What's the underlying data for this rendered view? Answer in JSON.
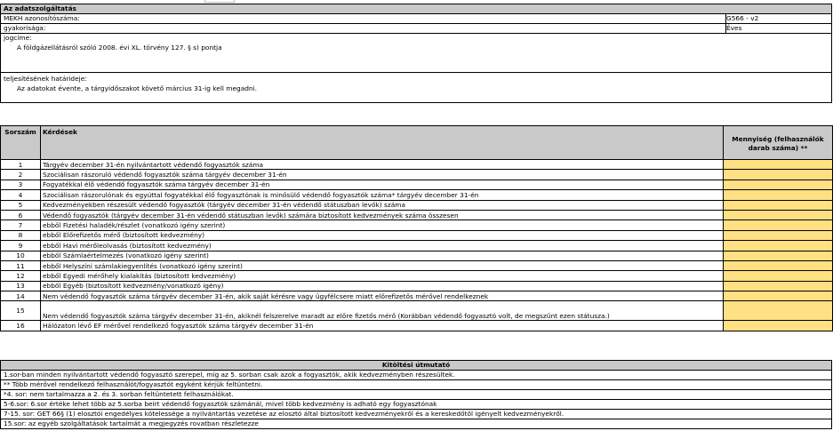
{
  "info": {
    "title": "Az adatszolgáltatás",
    "rows": [
      {
        "label": "MEKH azonosítószáma:",
        "value": "G566 - v2"
      },
      {
        "label": "gyakorisága:",
        "value": "Éves"
      }
    ],
    "legal_basis": {
      "label": "jogcíme:",
      "text": "A földgázellátásról szóló 2008. évi XL. törvény 127. § s) pontja"
    },
    "deadline": {
      "label": "teljesítésének határideje:",
      "text": "Az adatokat évente, a tárgyidőszakot követő március 31-ig kell megadni."
    }
  },
  "table": {
    "col_num": "Sorszám",
    "col_question": "Kérdések",
    "col_qty": "Mennyiség (felhasználók darab száma) **",
    "rows": [
      {
        "num": "1",
        "text": "Tárgyév december 31-én nyilvántartott védendő fogyasztók száma"
      },
      {
        "num": "2",
        "text": "Szociálisan rászoruló védendő fogyasztók száma tárgyév december 31-én"
      },
      {
        "num": "3",
        "text": "Fogyatékkal élő védendő fogyasztók száma tárgyév december 31-én"
      },
      {
        "num": "4",
        "text": "Szociálisan rászorulónak és egyúttal fogyatékkal élő fogyasztónak is minősülő védendő fogyasztók száma* tárgyév december 31-én"
      },
      {
        "num": "5",
        "text": "Kedvezményekben részesült védendő fogyasztók (tárgyév december 31-én védendő státuszban levők) száma"
      },
      {
        "num": "6",
        "text": "Védendő fogyasztók (tárgyév december 31-én védendő státuszban levők) számára biztosított kedvezmények száma összesen"
      },
      {
        "num": "7",
        "text": "ebből Fizetési haladék/részlet (vonatkozó igény szerint)"
      },
      {
        "num": "8",
        "text": "ebből Előrefizetős mérő (biztosított kedvezmény)"
      },
      {
        "num": "9",
        "text": "ebből Havi mérőleolvasás (biztosított kedvezmény)"
      },
      {
        "num": "10",
        "text": "ebből Számlaértelmezés (vonatkozó igény szerint)"
      },
      {
        "num": "11",
        "text": "ebből Helyszíni számlakiegyenlítés (vonatkozó igény szerint)"
      },
      {
        "num": "12",
        "text": "ebből Egyedi mérőhely kialakítás (biztosított kedvezmény)"
      },
      {
        "num": "13",
        "text": "ebből Egyéb (biztosított kedvezmény/vonatkozó igény)"
      },
      {
        "num": "14",
        "text": "Nem védendő fogyasztók száma tárgyév december 31-én, akik saját kérésre vagy ügyfélcsere miatt előrefizetős mérővel rendelkeznek"
      },
      {
        "num": "15",
        "text": "Nem védendő fogyasztók száma tárgyév december 31-én, akiknél felszerelve maradt az előre fizetős mérő (Korábban védendő fogyasztó volt, de megszűnt ezen státusza.)"
      },
      {
        "num": "16",
        "text": "Hálózaton lévő EF mérővel rendelkező fogyasztók száma tárgyév december 31-én"
      }
    ]
  },
  "instructions": {
    "title": "Kitöltési útmutató",
    "lines": [
      "1.sor-ban minden nyilvántartott védendő fogyasztó szerepel, míg az 5. sorban csak azok a fogyasztók, akik kedvezményben részesültek.",
      "** Több mérővel rendelkező felhasználót/fogyasztót egyként kérjük feltüntetni.",
      "*4. sor: nem tartalmazza a 2. és 3. sorban feltüntetett felhasználókat.",
      "5-6.sor: 6.sor értéke lehet több az 5.sorba beírt védendő fogyasztók számánál, mivel több kedvezmény is adható egy fogyasztónak",
      "7-15. sor: GET 66§ (1) elosztói engedélyes kötelessége a nyilvántartás vezetése az elosztó által biztosított kedvezményekről és a kereskedőtől igényelt kedvezményekről.",
      "15.sor: az egyéb szolgáltatások tartalmát a megjegyzés rovatban részletezze"
    ]
  },
  "colors": {
    "header_gray": "#c9c9c9",
    "input_yellow": "#ffe083"
  }
}
